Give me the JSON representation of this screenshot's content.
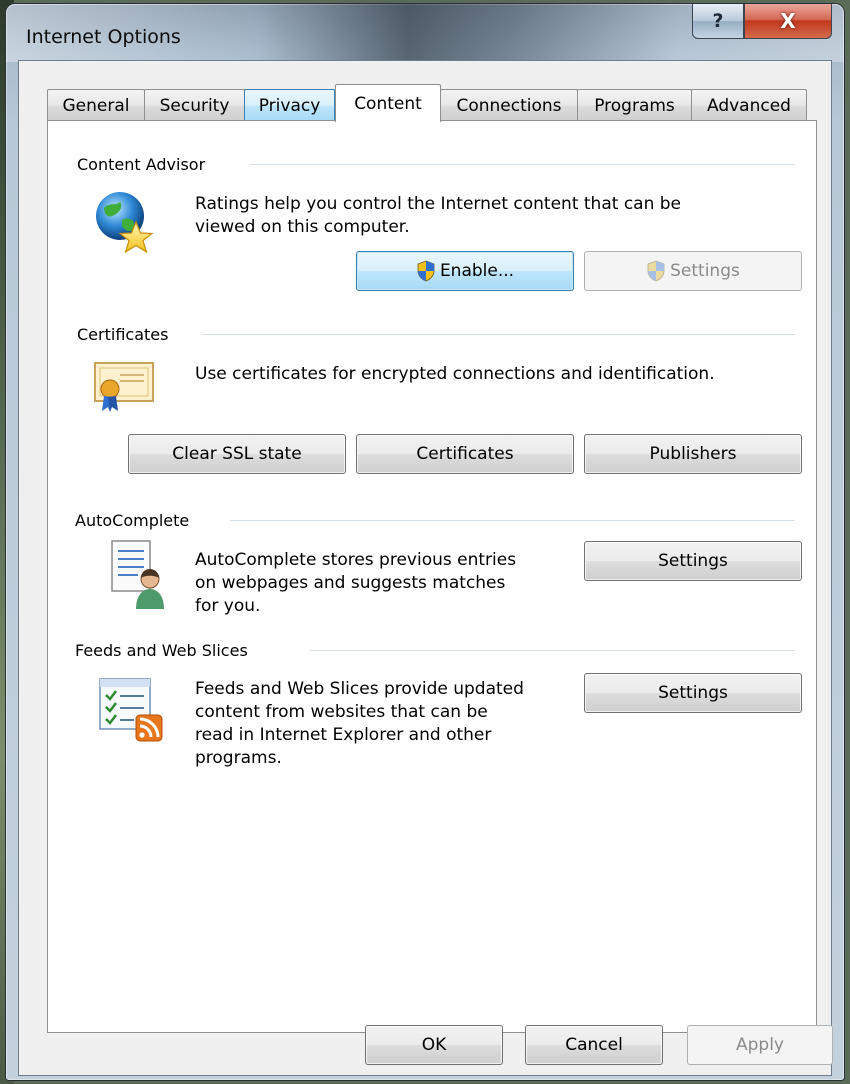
{
  "window": {
    "title": "Internet Options",
    "help_glyph": "?",
    "close_glyph": "X"
  },
  "tabs": [
    {
      "label": "General"
    },
    {
      "label": "Security"
    },
    {
      "label": "Privacy"
    },
    {
      "label": "Content"
    },
    {
      "label": "Connections"
    },
    {
      "label": "Programs"
    },
    {
      "label": "Advanced"
    }
  ],
  "active_tab": "Content",
  "content_advisor": {
    "title": "Content Advisor",
    "description_line1": "Ratings help you control the Internet content that can be",
    "description_line2": "viewed on this computer.",
    "enable_label": "Enable...",
    "settings_label": "Settings",
    "icon": "globe-star-icon"
  },
  "certificates": {
    "title": "Certificates",
    "description": "Use certificates for encrypted connections and identification.",
    "clear_ssl_label": "Clear SSL state",
    "certificates_label": "Certificates",
    "publishers_label": "Publishers",
    "icon": "certificate-icon"
  },
  "autocomplete": {
    "title": "AutoComplete",
    "description_line1": "AutoComplete stores previous entries",
    "description_line2": "on webpages and suggests matches",
    "description_line3": "for you.",
    "settings_label": "Settings",
    "icon": "autocomplete-icon"
  },
  "feeds": {
    "title": "Feeds and Web Slices",
    "description_line1": "Feeds and Web Slices provide updated",
    "description_line2": "content from websites that can be",
    "description_line3": "read in Internet Explorer and other",
    "description_line4": "programs.",
    "settings_label": "Settings",
    "icon": "feed-icon"
  },
  "footer": {
    "ok_label": "OK",
    "cancel_label": "Cancel",
    "apply_label": "Apply"
  },
  "colors": {
    "accent": "#3c7fb1",
    "close_red": "#c2391e",
    "rss_orange": "#e8761c"
  }
}
